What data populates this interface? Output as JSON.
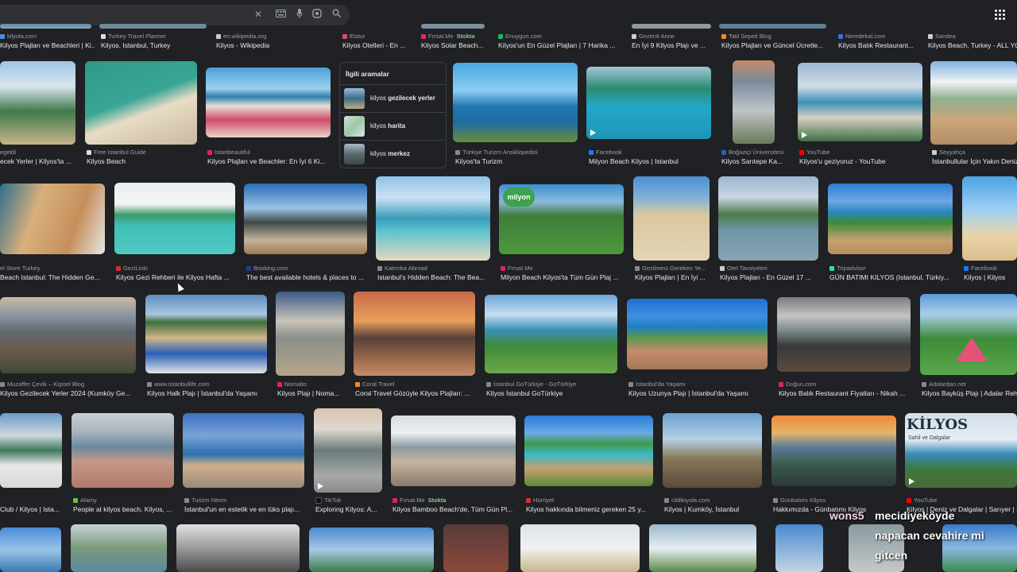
{
  "toolbar": {
    "icons": [
      "close-icon",
      "keyboard-icon",
      "mic-icon",
      "lens-icon",
      "search-icon",
      "apps-icon"
    ]
  },
  "related": {
    "title": "İlgili aramalar",
    "items": [
      {
        "bold_part": "kilyos",
        "rest": "gezilecek yerler"
      },
      {
        "bold_part": "kilyos",
        "rest": "harita"
      },
      {
        "bold_part": "kilyos",
        "rest": "merkez"
      }
    ]
  },
  "captions": {
    "row0": [
      {
        "src": "kilyola.com",
        "title": "Kilyos Plajları ve Beachleri | Ki..."
      },
      {
        "src": "Turkey Travel Planner",
        "title": "Kilyos, Istanbul, Turkey"
      },
      {
        "src": "en.wikipedia.org",
        "title": "Kilyos - Wikipedia"
      },
      {
        "src": "Etstur",
        "title": "Kilyos Otelleri - En ..."
      },
      {
        "src": "Fırsat.Me",
        "stock": "Stokta",
        "title": "Kilyos Solar Beach..."
      },
      {
        "src": "Enuygun.com",
        "title": "Kilyos'un En Güzel Plajları | 7 Harika ..."
      },
      {
        "src": "Gezenti Anne",
        "title": "En İyi 9 Kilyos Plajı ve ..."
      },
      {
        "src": "Tatil Sepeti Blog",
        "title": "Kilyos Plajları ve Güncel Ücretle..."
      },
      {
        "src": "Neredekal.com",
        "title": "Kilyos Balık Restaurant..."
      },
      {
        "src": "Sandea",
        "title": "Kilyos Beach, Turkey - ALL YO..."
      }
    ],
    "row1": [
      {
        "src": "egeldi",
        "title": "ecek Yerler | Kilyos'ta ..."
      },
      {
        "src": "Free Istanbul Guide",
        "title": "Kilyos Beach"
      },
      {
        "src": "Istanbeautiful",
        "title": "Kilyos Plajları ve Beachler: En İyi 6 Ki..."
      },
      {
        "src": "Türkiye Turizm Ansiklopedisi",
        "title": "Kilyos'ta Turizm"
      },
      {
        "src": "Facebook",
        "title": "Milyon Beach Kilyos | Istanbul"
      },
      {
        "src": "Boğaziçi Üniversitesi",
        "title": "Kilyos Sarıtepe Ka..."
      },
      {
        "src": "YouTube",
        "title": "Kilyos'u geziyoruz - YouTube"
      },
      {
        "src": "Seyyahça",
        "title": "İstanbullular İçin Yakın Deniz..."
      }
    ],
    "row2": [
      {
        "src": "el Store Turkey",
        "title": "Beach Istanbul: The Hidden Ge..."
      },
      {
        "src": "GeziLinki",
        "title": "Kilyos Gezi Rehberi ile Kilyos Hafta ..."
      },
      {
        "src": "Booking.com",
        "title": "The best available hotels & places to ..."
      },
      {
        "src": "Katrınka Abroad",
        "title": "Istanbul's Hidden Beach: The Bea..."
      },
      {
        "src": "Fırsat.Me",
        "title": "Milyon Beach Kilyos'ta Tüm Gün Plaj ..."
      },
      {
        "src": "Gezilmesi Gereken Ye...",
        "title": "Kilyos Plajları | En İyi ..."
      },
      {
        "src": "Otel Tavsiyeleri",
        "title": "Kilyos Plajları - En Güzel 17 ..."
      },
      {
        "src": "Tripadvisor",
        "title": "GÜN BATIMI KILYOS (Istanbul, Türkiy..."
      },
      {
        "src": "Facebook",
        "title": "Kilyos | Kilyos"
      }
    ],
    "row3": [
      {
        "src": "Muzaffer Çevik – Kişisel Blog",
        "title": "Kilyos Gezilecek Yerler 2024 (Kumköy Ge..."
      },
      {
        "src": "www.istanbullife.com",
        "title": "Kilyos Halk Plajı | İstanbul'da Yaşamı"
      },
      {
        "src": "Nomalto",
        "title": "Kilyos Plajı | Noma..."
      },
      {
        "src": "Coral Travel",
        "title": "Coral Travel Gözüyle Kilyos Plajları: ..."
      },
      {
        "src": "İstanbul GoTürkiye - GoTürkiye",
        "title": "Kilyos İstanbul GoTürkiye"
      },
      {
        "src": "İstanbul'da Yaşamı",
        "title": "Kilyos Uzunya Plajı | İstanbul'da Yaşamı"
      },
      {
        "src": "Doğun.com",
        "title": "Kilyos Balık Restaurant Fiyatları - Nikah ..."
      },
      {
        "src": "Adalardan.net",
        "title": "Kilyos Bayküş Plajı | Adalar Reh..."
      }
    ],
    "row4": [
      {
        "src": "",
        "title": "Club / Kilyos | Ista..."
      },
      {
        "src": "Alamy",
        "title": "People at kilyos beach. Kilyos, ..."
      },
      {
        "src": "Turizm Nevm",
        "title": "İstanbul'un en estetik ve en lüks plajı..."
      },
      {
        "src": "TikTok",
        "title": "Exploring Kilyos: A..."
      },
      {
        "src": "Fırsat.Me",
        "stock": "Stokta",
        "title": "Kilyos Bamboo Beach'de, Tüm Gün Pl..."
      },
      {
        "src": "Hürriyet",
        "title": "Kilyos hakkında bilmeniz gereken 25 y..."
      },
      {
        "src": "cildikiyola.com",
        "title": "Kilyos | Kumköy, İstanbul"
      },
      {
        "src": "Günbatımı Kilyos",
        "title": "Hakkımızda - Günbatımı Kilyos"
      },
      {
        "src": "YouTube",
        "title": "Kilyos | Deniz ve Dalgalar | Sarıyer | ..."
      }
    ]
  },
  "thumb_text": {
    "milyon_logo": "milyon",
    "kilyos_banner": "KİLYOS",
    "kilyos_sub": "Sahil ve Dalgalar"
  },
  "overlay": {
    "channel": "wons5",
    "line1": "mecidiyeköyde",
    "line2": "napacan cevahire mi",
    "line3": "gitcen"
  }
}
